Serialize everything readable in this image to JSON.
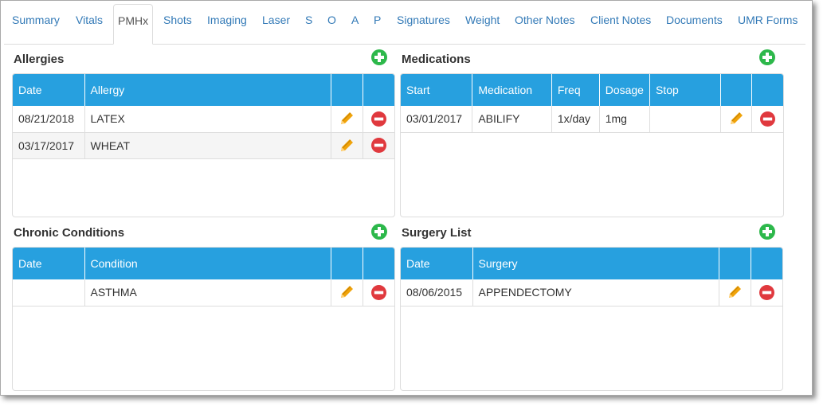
{
  "tabs": [
    {
      "label": "Summary"
    },
    {
      "label": "Vitals"
    },
    {
      "label": "PMHx"
    },
    {
      "label": "Shots"
    },
    {
      "label": "Imaging"
    },
    {
      "label": "Laser"
    },
    {
      "label": "S"
    },
    {
      "label": "O"
    },
    {
      "label": "A"
    },
    {
      "label": "P"
    },
    {
      "label": "Signatures"
    },
    {
      "label": "Weight"
    },
    {
      "label": "Other Notes"
    },
    {
      "label": "Client Notes"
    },
    {
      "label": "Documents"
    },
    {
      "label": "UMR Forms"
    }
  ],
  "active_tab": "PMHx",
  "allergies": {
    "title": "Allergies",
    "headers": [
      "Date",
      "Allergy"
    ],
    "rows": [
      {
        "date": "08/21/2018",
        "allergy": "LATEX"
      },
      {
        "date": "03/17/2017",
        "allergy": "WHEAT"
      }
    ]
  },
  "medications": {
    "title": "Medications",
    "headers": [
      "Start",
      "Medication",
      "Freq",
      "Dosage",
      "Stop"
    ],
    "rows": [
      {
        "start": "03/01/2017",
        "medication": "ABILIFY",
        "freq": "1x/day",
        "dosage": "1mg",
        "stop": ""
      }
    ]
  },
  "chronic": {
    "title": "Chronic Conditions",
    "headers": [
      "Date",
      "Condition"
    ],
    "rows": [
      {
        "date": "",
        "condition": "ASTHMA"
      }
    ]
  },
  "surgery": {
    "title": "Surgery List",
    "headers": [
      "Date",
      "Surgery"
    ],
    "rows": [
      {
        "date": "08/06/2015",
        "surgery": "APPENDECTOMY"
      }
    ]
  },
  "colors": {
    "header_blue": "#27a0df",
    "link_blue": "#337ab7",
    "add_green": "#2db84b",
    "remove_red": "#e0393e",
    "edit_orange": "#f0a30a"
  },
  "icons": {
    "add": "plus-circle-icon",
    "edit": "pencil-icon",
    "remove": "minus-circle-icon"
  }
}
